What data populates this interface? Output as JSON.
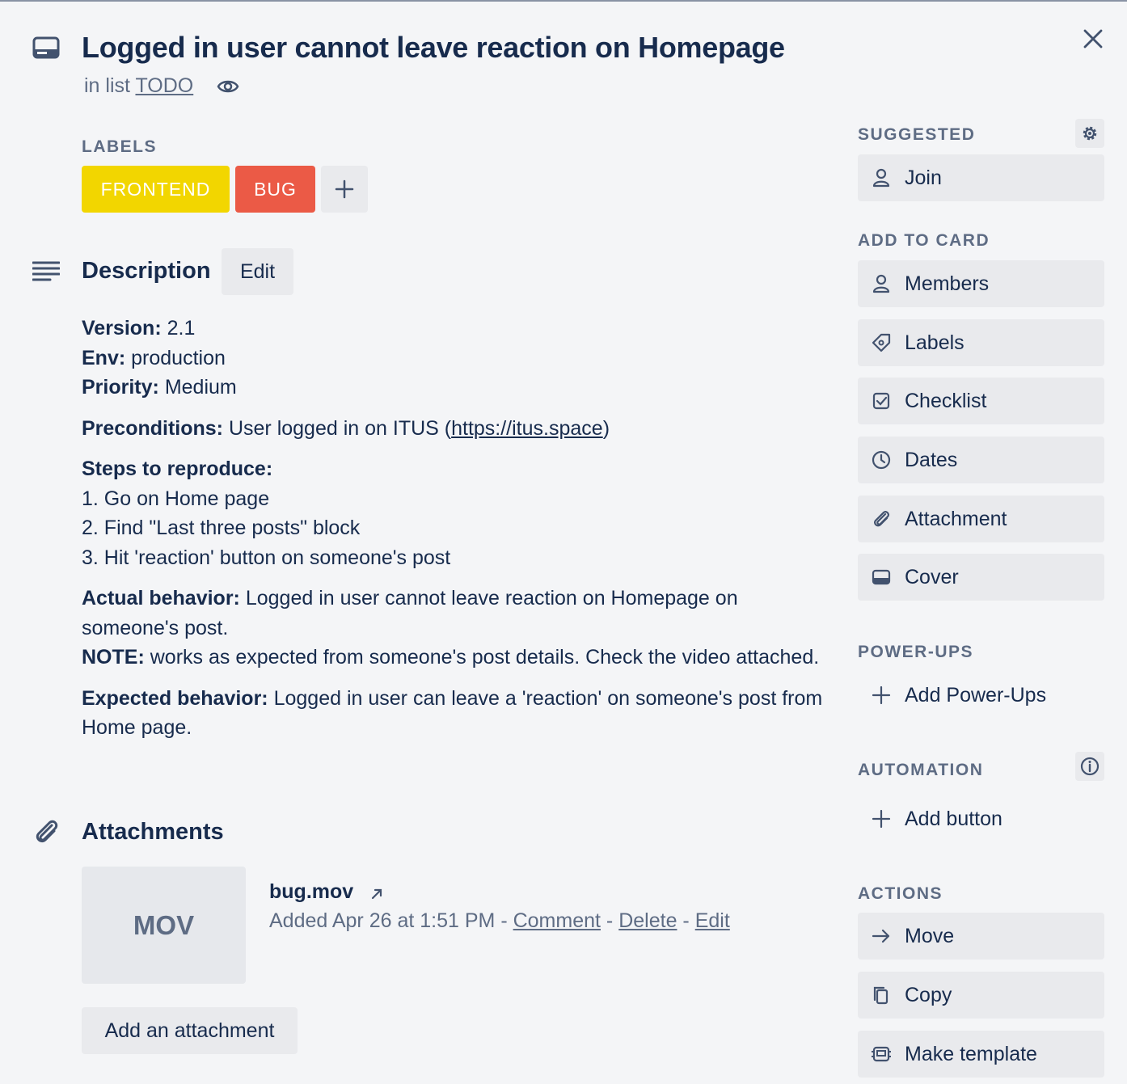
{
  "card": {
    "title": "Logged in user cannot leave reaction on Homepage",
    "in_list_prefix": "in list",
    "list_name": "TODO"
  },
  "labels_section": {
    "heading": "LABELS",
    "items": [
      {
        "name": "FRONTEND",
        "color": "#f2d600"
      },
      {
        "name": "BUG",
        "color": "#eb5a46"
      }
    ]
  },
  "description": {
    "heading": "Description",
    "edit_label": "Edit",
    "version_key": "Version:",
    "version_val": "2.1",
    "env_key": "Env:",
    "env_val": "production",
    "priority_key": "Priority:",
    "priority_val": "Medium",
    "preconditions_key": "Preconditions:",
    "preconditions_text": "User logged in on ITUS (",
    "preconditions_link": "https://itus.space",
    "preconditions_close": ")",
    "steps_key": "Steps to reproduce:",
    "steps": [
      "1. Go on Home page",
      "2. Find \"Last three posts\" block",
      "3. Hit 'reaction' button on someone's post"
    ],
    "actual_key": "Actual behavior:",
    "actual_text": "Logged in user cannot leave reaction on Homepage on someone's post.",
    "note_key": "NOTE:",
    "note_text": "works as expected from someone's post details. Check the video attached.",
    "expected_key": "Expected behavior:",
    "expected_text": "Logged in user can leave a 'reaction' on someone's post from Home page."
  },
  "attachments": {
    "heading": "Attachments",
    "items": [
      {
        "thumb_text": "MOV",
        "name": "bug.mov",
        "added_text": "Added Apr 26 at 1:51 PM",
        "sep": "-",
        "comment_label": "Comment",
        "delete_label": "Delete",
        "edit_label": "Edit"
      }
    ],
    "add_label": "Add an attachment"
  },
  "sidebar": {
    "suggested_heading": "SUGGESTED",
    "join_label": "Join",
    "add_to_card_heading": "ADD TO CARD",
    "add_to_card": [
      {
        "label": "Members",
        "icon": "person-icon"
      },
      {
        "label": "Labels",
        "icon": "tag-icon"
      },
      {
        "label": "Checklist",
        "icon": "checklist-icon"
      },
      {
        "label": "Dates",
        "icon": "clock-icon"
      },
      {
        "label": "Attachment",
        "icon": "paperclip-icon"
      },
      {
        "label": "Cover",
        "icon": "cover-icon"
      }
    ],
    "powerups_heading": "POWER-UPS",
    "add_powerups_label": "Add Power-Ups",
    "automation_heading": "AUTOMATION",
    "add_button_label": "Add button",
    "actions_heading": "ACTIONS",
    "actions": [
      {
        "label": "Move",
        "icon": "arrow-right-icon"
      },
      {
        "label": "Copy",
        "icon": "copy-icon"
      },
      {
        "label": "Make template",
        "icon": "template-icon"
      }
    ]
  }
}
